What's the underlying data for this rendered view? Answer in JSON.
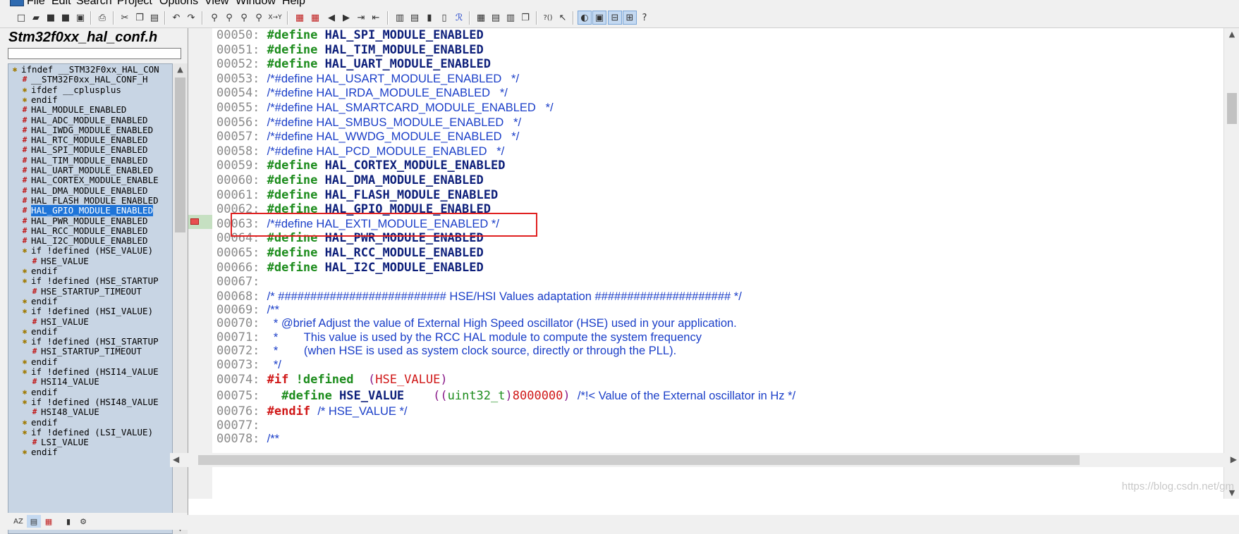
{
  "menu": [
    "File",
    "Edit",
    "Search",
    "Project",
    "Options",
    "View",
    "Window",
    "Help"
  ],
  "file_title": "Stm32f0xx_hal_conf.h",
  "filter_value": "",
  "tree_items": [
    {
      "label": "ifndef __STM32F0xx_HAL_CON",
      "icon": "cond",
      "indent": 0
    },
    {
      "label": "__STM32F0xx_HAL_CONF_H",
      "icon": "hash",
      "indent": 1
    },
    {
      "label": "ifdef __cplusplus",
      "icon": "cond",
      "indent": 1
    },
    {
      "label": "endif",
      "icon": "cond",
      "indent": 1
    },
    {
      "label": "HAL_MODULE_ENABLED",
      "icon": "hash",
      "indent": 1
    },
    {
      "label": "HAL_ADC_MODULE_ENABLED",
      "icon": "hash",
      "indent": 1
    },
    {
      "label": "HAL_IWDG_MODULE_ENABLED",
      "icon": "hash",
      "indent": 1
    },
    {
      "label": "HAL_RTC_MODULE_ENABLED",
      "icon": "hash",
      "indent": 1
    },
    {
      "label": "HAL_SPI_MODULE_ENABLED",
      "icon": "hash",
      "indent": 1
    },
    {
      "label": "HAL_TIM_MODULE_ENABLED",
      "icon": "hash",
      "indent": 1
    },
    {
      "label": "HAL_UART_MODULE_ENABLED",
      "icon": "hash",
      "indent": 1
    },
    {
      "label": "HAL_CORTEX_MODULE_ENABLE",
      "icon": "hash",
      "indent": 1
    },
    {
      "label": "HAL_DMA_MODULE_ENABLED",
      "icon": "hash",
      "indent": 1
    },
    {
      "label": "HAL_FLASH_MODULE_ENABLED",
      "icon": "hash",
      "indent": 1
    },
    {
      "label": "HAL_GPIO_MODULE_ENABLED",
      "icon": "hash",
      "indent": 1,
      "selected": true
    },
    {
      "label": "HAL_PWR_MODULE_ENABLED",
      "icon": "hash",
      "indent": 1
    },
    {
      "label": "HAL_RCC_MODULE_ENABLED",
      "icon": "hash",
      "indent": 1
    },
    {
      "label": "HAL_I2C_MODULE_ENABLED",
      "icon": "hash",
      "indent": 1
    },
    {
      "label": "if !defined (HSE_VALUE)",
      "icon": "cond",
      "indent": 1
    },
    {
      "label": "HSE_VALUE",
      "icon": "hash",
      "indent": 2
    },
    {
      "label": "endif",
      "icon": "cond",
      "indent": 1
    },
    {
      "label": "if !defined (HSE_STARTUP",
      "icon": "cond",
      "indent": 1
    },
    {
      "label": "HSE_STARTUP_TIMEOUT",
      "icon": "hash",
      "indent": 2
    },
    {
      "label": "endif",
      "icon": "cond",
      "indent": 1
    },
    {
      "label": "if !defined (HSI_VALUE)",
      "icon": "cond",
      "indent": 1
    },
    {
      "label": "HSI_VALUE",
      "icon": "hash",
      "indent": 2
    },
    {
      "label": "endif",
      "icon": "cond",
      "indent": 1
    },
    {
      "label": "if !defined (HSI_STARTUP",
      "icon": "cond",
      "indent": 1
    },
    {
      "label": "HSI_STARTUP_TIMEOUT",
      "icon": "hash",
      "indent": 2
    },
    {
      "label": "endif",
      "icon": "cond",
      "indent": 1
    },
    {
      "label": "if !defined (HSI14_VALUE",
      "icon": "cond",
      "indent": 1
    },
    {
      "label": "HSI14_VALUE",
      "icon": "hash",
      "indent": 2
    },
    {
      "label": "endif",
      "icon": "cond",
      "indent": 1
    },
    {
      "label": "if !defined (HSI48_VALUE",
      "icon": "cond",
      "indent": 1
    },
    {
      "label": "HSI48_VALUE",
      "icon": "hash",
      "indent": 2
    },
    {
      "label": "endif",
      "icon": "cond",
      "indent": 1
    },
    {
      "label": "if !defined (LSI_VALUE)",
      "icon": "cond",
      "indent": 1
    },
    {
      "label": "LSI_VALUE",
      "icon": "hash",
      "indent": 2
    },
    {
      "label": "endif",
      "icon": "cond",
      "indent": 1
    }
  ],
  "code_lines": [
    {
      "n": "00050:",
      "parts": [
        {
          "c": "kw",
          "t": "#define "
        },
        {
          "c": "macro",
          "t": "HAL_SPI_MODULE_ENABLED"
        }
      ]
    },
    {
      "n": "00051:",
      "parts": [
        {
          "c": "kw",
          "t": "#define "
        },
        {
          "c": "macro",
          "t": "HAL_TIM_MODULE_ENABLED"
        }
      ]
    },
    {
      "n": "00052:",
      "parts": [
        {
          "c": "kw",
          "t": "#define "
        },
        {
          "c": "macro",
          "t": "HAL_UART_MODULE_ENABLED"
        }
      ]
    },
    {
      "n": "00053:",
      "parts": [
        {
          "c": "comment",
          "t": "/*#define HAL_USART_MODULE_ENABLED   */"
        }
      ]
    },
    {
      "n": "00054:",
      "parts": [
        {
          "c": "comment",
          "t": "/*#define HAL_IRDA_MODULE_ENABLED   */"
        }
      ]
    },
    {
      "n": "00055:",
      "parts": [
        {
          "c": "comment",
          "t": "/*#define HAL_SMARTCARD_MODULE_ENABLED   */"
        }
      ]
    },
    {
      "n": "00056:",
      "parts": [
        {
          "c": "comment",
          "t": "/*#define HAL_SMBUS_MODULE_ENABLED   */"
        }
      ]
    },
    {
      "n": "00057:",
      "parts": [
        {
          "c": "comment",
          "t": "/*#define HAL_WWDG_MODULE_ENABLED   */"
        }
      ]
    },
    {
      "n": "00058:",
      "parts": [
        {
          "c": "comment",
          "t": "/*#define HAL_PCD_MODULE_ENABLED   */"
        }
      ]
    },
    {
      "n": "00059:",
      "parts": [
        {
          "c": "kw",
          "t": "#define "
        },
        {
          "c": "macro",
          "t": "HAL_CORTEX_MODULE_ENABLED"
        }
      ]
    },
    {
      "n": "00060:",
      "parts": [
        {
          "c": "kw",
          "t": "#define "
        },
        {
          "c": "macro",
          "t": "HAL_DMA_MODULE_ENABLED"
        }
      ]
    },
    {
      "n": "00061:",
      "parts": [
        {
          "c": "kw",
          "t": "#define "
        },
        {
          "c": "macro",
          "t": "HAL_FLASH_MODULE_ENABLED"
        }
      ]
    },
    {
      "n": "00062:",
      "parts": [
        {
          "c": "kw",
          "t": "#define "
        },
        {
          "c": "macro",
          "t": "HAL_GPIO_MODULE_ENABLED"
        }
      ]
    },
    {
      "n": "00063:",
      "parts": [
        {
          "c": "comment",
          "t": "/*#define HAL_EXTI_MODULE_ENABLED */"
        }
      ]
    },
    {
      "n": "00064:",
      "parts": [
        {
          "c": "kw",
          "t": "#define "
        },
        {
          "c": "macro",
          "t": "HAL_PWR_MODULE_ENABLED"
        }
      ]
    },
    {
      "n": "00065:",
      "parts": [
        {
          "c": "kw",
          "t": "#define "
        },
        {
          "c": "macro",
          "t": "HAL_RCC_MODULE_ENABLED"
        }
      ]
    },
    {
      "n": "00066:",
      "parts": [
        {
          "c": "kw",
          "t": "#define "
        },
        {
          "c": "macro",
          "t": "HAL_I2C_MODULE_ENABLED"
        }
      ]
    },
    {
      "n": "00067:",
      "parts": []
    },
    {
      "n": "00068:",
      "parts": [
        {
          "c": "comment",
          "t": "/* ########################## HSE/HSI Values adaptation ##################### */"
        }
      ]
    },
    {
      "n": "00069:",
      "parts": [
        {
          "c": "comment",
          "t": "/**"
        }
      ]
    },
    {
      "n": "00070:",
      "parts": [
        {
          "c": "comment",
          "t": "  * @brief Adjust the value of External High Speed oscillator (HSE) used in your application."
        }
      ]
    },
    {
      "n": "00071:",
      "parts": [
        {
          "c": "comment",
          "t": "  *        This value is used by the RCC HAL module to compute the system frequency"
        }
      ]
    },
    {
      "n": "00072:",
      "parts": [
        {
          "c": "comment",
          "t": "  *        (when HSE is used as system clock source, directly or through the PLL)."
        }
      ]
    },
    {
      "n": "00073:",
      "parts": [
        {
          "c": "comment",
          "t": "  */"
        }
      ]
    },
    {
      "n": "00074:",
      "parts": [
        {
          "c": "pp-red",
          "t": "#if "
        },
        {
          "c": "kw",
          "t": "!defined  "
        },
        {
          "c": "purple",
          "t": "("
        },
        {
          "c": "red",
          "t": "HSE_VALUE"
        },
        {
          "c": "purple",
          "t": ")"
        }
      ]
    },
    {
      "n": "00075:",
      "parts": [
        {
          "c": "sp-mono",
          "t": "  "
        },
        {
          "c": "kw",
          "t": "#define "
        },
        {
          "c": "macro",
          "t": "HSE_VALUE"
        },
        {
          "c": "sp-mono",
          "t": "    "
        },
        {
          "c": "purple",
          "t": "(("
        },
        {
          "c": "type",
          "t": "uint32_t"
        },
        {
          "c": "purple",
          "t": ")"
        },
        {
          "c": "red",
          "t": "8000000"
        },
        {
          "c": "purple",
          "t": ")"
        },
        {
          "c": "sp-mono",
          "t": " "
        },
        {
          "c": "comment",
          "t": "/*!< Value of the External oscillator in Hz */"
        }
      ]
    },
    {
      "n": "00076:",
      "parts": [
        {
          "c": "pp-red",
          "t": "#endif "
        },
        {
          "c": "comment",
          "t": "/* HSE_VALUE */"
        }
      ]
    },
    {
      "n": "00077:",
      "parts": []
    },
    {
      "n": "00078:",
      "parts": [
        {
          "c": "comment",
          "t": "/**"
        }
      ]
    }
  ],
  "watermark": "https://blog.csdn.net/gm"
}
